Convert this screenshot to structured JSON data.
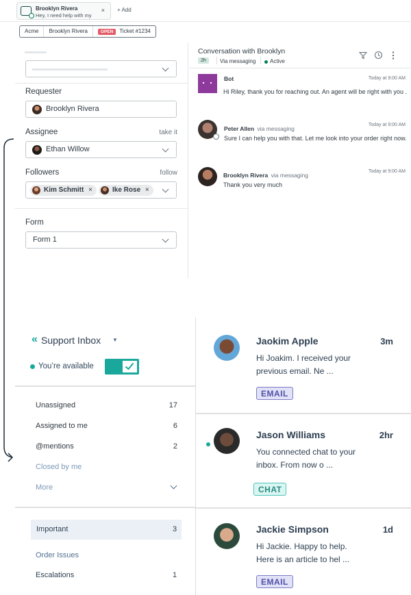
{
  "tab": {
    "name": "Brooklyn Rivera",
    "preview": "Hey, I need help with my",
    "close": "×"
  },
  "add_tab": "+ Add",
  "breadcrumb": {
    "org": "Acme",
    "user": "Brooklyn Rivera",
    "status": "OPEN",
    "ticket": "Ticket #1234"
  },
  "properties": {
    "requester_label": "Requester",
    "requester_value": "Brooklyn Rivera",
    "assignee_label": "Assignee",
    "assignee_link": "take it",
    "assignee_value": "Ethan Willow",
    "followers_label": "Followers",
    "followers_link": "follow",
    "followers": [
      {
        "name": "Kim Schmitt",
        "remove": "×"
      },
      {
        "name": "Ike Rose",
        "remove": "×"
      }
    ],
    "form_label": "Form",
    "form_value": "Form 1"
  },
  "conversation": {
    "title": "Conversation with Brooklyn",
    "age": "2h",
    "channel": "Via messaging",
    "status": "Active",
    "messages": [
      {
        "author": "Bot",
        "via": "",
        "time": "Today at 9:00 AM",
        "text": "Hi Riley, thank you for reaching out. An agent will be right with you ."
      },
      {
        "author": "Peter Allen",
        "via": "via messaging",
        "time": "Today at 9:00 AM",
        "text": "Sure I can help you with that. Let me look into your order right now."
      },
      {
        "author": "Brooklyn Rivera",
        "via": "via messaging",
        "time": "Today at 9:00 AM",
        "text": "Thank you very much"
      }
    ]
  },
  "inbox": {
    "title": "Support Inbox",
    "availability": "You’re available",
    "nav": [
      {
        "label": "Unassigned",
        "count": "17"
      },
      {
        "label": "Assigned to me",
        "count": "6"
      },
      {
        "label": "@mentions",
        "count": "2"
      },
      {
        "label": "Closed by me",
        "count": ""
      },
      {
        "label": "More",
        "count": ""
      }
    ],
    "views": [
      {
        "label": "Important",
        "count": "3"
      },
      {
        "label": "Order Issues",
        "count": ""
      },
      {
        "label": "Escalations",
        "count": "1"
      }
    ],
    "conversations": [
      {
        "name": "Jaokim Apple",
        "time": "3m",
        "preview": "Hi Joakim. I received your previous email. Ne ...",
        "tag": "EMAIL"
      },
      {
        "name": "Jason Williams",
        "time": "2hr",
        "preview": "You connected chat to your inbox. From now o ...",
        "tag": "CHAT"
      },
      {
        "name": "Jackie Simpson",
        "time": "1d",
        "preview": "Hi Jackie. Happy to help. Here is an article to hel ...",
        "tag": "EMAIL"
      }
    ]
  },
  "colors": {
    "teal": "#1aa89c",
    "open_red": "#e35b66",
    "bot_purple": "#8e3a9d",
    "active_green": "#038153"
  }
}
